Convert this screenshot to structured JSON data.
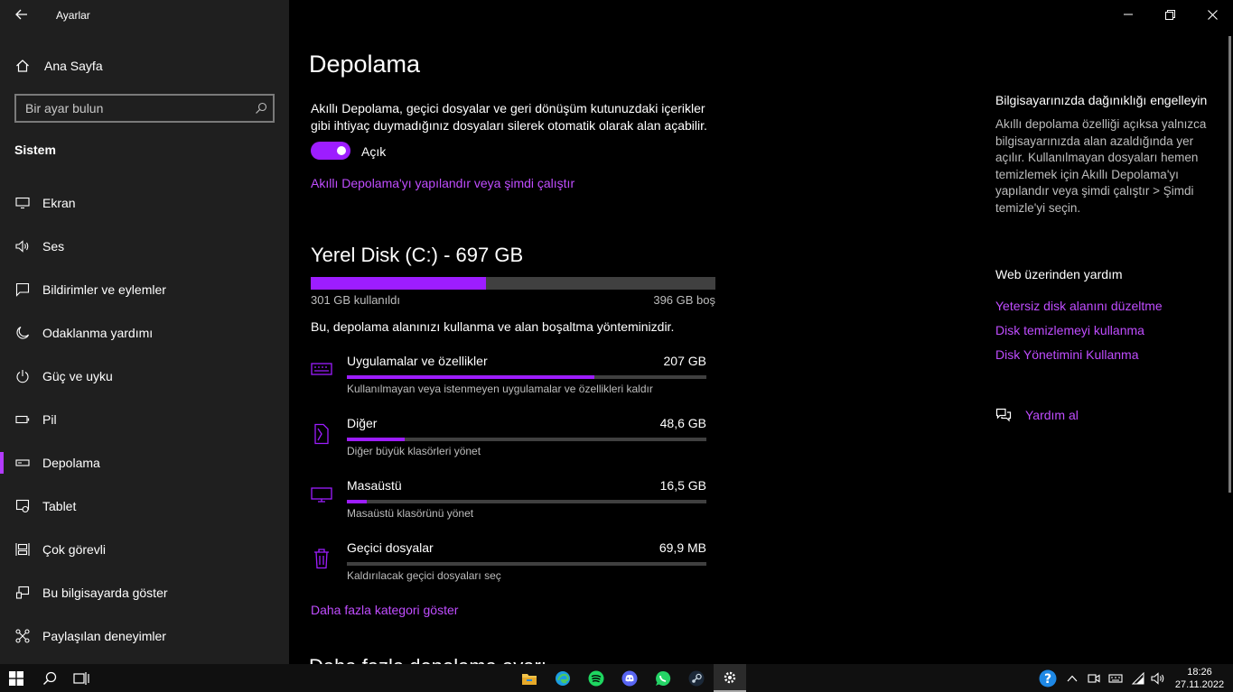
{
  "app": {
    "title": "Ayarlar"
  },
  "sidebar": {
    "home_label": "Ana Sayfa",
    "search_placeholder": "Bir ayar bulun",
    "section_title": "Sistem",
    "items": [
      {
        "label": "Ekran",
        "icon": "monitor-icon"
      },
      {
        "label": "Ses",
        "icon": "speaker-icon"
      },
      {
        "label": "Bildirimler ve eylemler",
        "icon": "notification-icon"
      },
      {
        "label": "Odaklanma yardımı",
        "icon": "moon-icon"
      },
      {
        "label": "Güç ve uyku",
        "icon": "power-icon"
      },
      {
        "label": "Pil",
        "icon": "battery-icon"
      },
      {
        "label": "Depolama",
        "icon": "storage-icon",
        "active": true
      },
      {
        "label": "Tablet",
        "icon": "tablet-icon"
      },
      {
        "label": "Çok görevli",
        "icon": "multitasking-icon"
      },
      {
        "label": "Bu bilgisayarda göster",
        "icon": "project-icon"
      },
      {
        "label": "Paylaşılan deneyimler",
        "icon": "shared-experiences-icon"
      }
    ]
  },
  "main": {
    "title": "Depolama",
    "description": "Akıllı Depolama, geçici dosyalar ve geri dönüşüm kutunuzdaki içerikler gibi ihtiyaç duymadığınız dosyaları silerek otomatik olarak alan açabilir.",
    "toggle_label": "Açık",
    "toggle_on": true,
    "configure_link": "Akıllı Depolama'yı yapılandır veya şimdi çalıştır",
    "disk": {
      "title": "Yerel Disk (C:) - 697 GB",
      "used_label": "301 GB kullanıldı",
      "free_label": "396 GB boş",
      "used_fraction": 0.432
    },
    "usage_description": "Bu, depolama alanınızı kullanma ve alan boşaltma yönteminizdir.",
    "categories": [
      {
        "name": "Uygulamalar ve özellikler",
        "size": "207 GB",
        "sub": "Kullanılmayan veya istenmeyen uygulamalar ve özellikleri kaldır",
        "fraction": 0.688,
        "icon": "apps-keyboard-icon"
      },
      {
        "name": "Diğer",
        "size": "48,6 GB",
        "sub": "Diğer büyük klasörleri yönet",
        "fraction": 0.16,
        "icon": "other-document-icon"
      },
      {
        "name": "Masaüstü",
        "size": "16,5 GB",
        "sub": "Masaüstü klasörünü yönet",
        "fraction": 0.055,
        "icon": "desktop-icon"
      },
      {
        "name": "Geçici dosyalar",
        "size": "69,9 MB",
        "sub": "Kaldırılacak geçici dosyaları seç",
        "fraction": 0.0,
        "icon": "trash-icon"
      }
    ],
    "more_link": "Daha fazla kategori göster",
    "cutoff_heading": "Daha fazla depolama ayarı"
  },
  "right": {
    "title": "Bilgisayarınızda dağınıklığı engelleyin",
    "text": "Akıllı depolama özelliği açıksa yalnızca bilgisayarınızda alan azaldığında yer açılır. Kullanılmayan dosyaları hemen temizlemek için Akıllı Depolama'yı yapılandır veya şimdi çalıştır > Şimdi temizle'yi seçin.",
    "web_title": "Web üzerinden yardım",
    "links": [
      "Yetersiz disk alanını düzeltme",
      "Disk temizlemeyi kullanma",
      "Disk Yönetimini Kullanma"
    ],
    "help_label": "Yardım al"
  },
  "taskbar": {
    "time": "18:26",
    "date": "27.11.2022",
    "apps": [
      "file-explorer-icon",
      "edge-icon",
      "spotify-icon",
      "discord-icon",
      "whatsapp-icon",
      "steam-icon",
      "settings-icon"
    ]
  },
  "colors": {
    "accent": "#9d1dff",
    "link": "#c04dff",
    "sidebar_bg": "#1f1f1f",
    "main_bg": "#000000"
  }
}
